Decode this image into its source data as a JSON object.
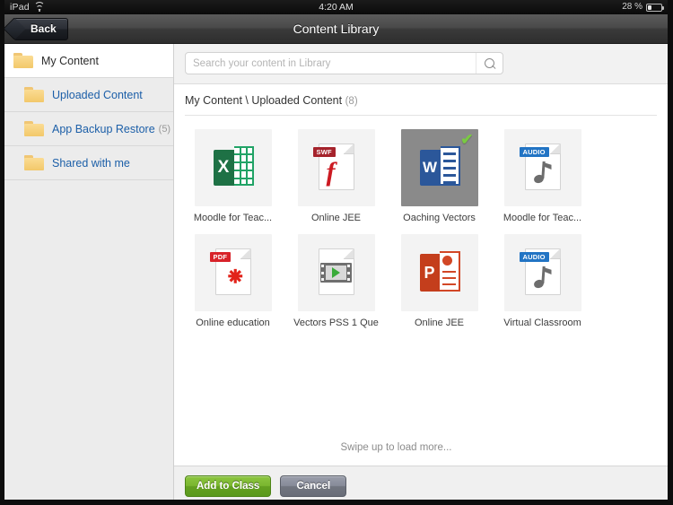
{
  "status_bar": {
    "carrier": "iPad",
    "wifi_icon": "wifi-icon",
    "time": "4:20 AM",
    "battery_percent": "28 %",
    "battery_level": 28
  },
  "nav_bar": {
    "back_label": "Back",
    "title": "Content Library"
  },
  "sidebar": {
    "items": [
      {
        "label": "My Content",
        "count": "",
        "level": "root",
        "icon": "folder-icon"
      },
      {
        "label": "Uploaded Content",
        "count": "",
        "level": "child",
        "icon": "folder-icon"
      },
      {
        "label": "App Backup Restore",
        "count": "(5)",
        "level": "child",
        "icon": "folder-icon"
      },
      {
        "label": "Shared with me",
        "count": "",
        "level": "child",
        "icon": "folder-icon"
      }
    ]
  },
  "search": {
    "value": "",
    "placeholder": "Search your content in Library",
    "icon": "search-icon"
  },
  "breadcrumb": {
    "path": "My Content \\ Uploaded Content",
    "count": "(8)"
  },
  "grid": {
    "tiles": [
      {
        "label": "Moodle for Teac...",
        "type": "excel",
        "selected": false,
        "letter": "X"
      },
      {
        "label": "Online JEE",
        "type": "swf",
        "selected": false,
        "badge": "SWF"
      },
      {
        "label": "Oaching Vectors",
        "type": "word",
        "selected": true,
        "letter": "W",
        "check": "✔"
      },
      {
        "label": "Moodle for Teac...",
        "type": "audio",
        "selected": false,
        "badge": "AUDIO"
      },
      {
        "label": "Online education",
        "type": "pdf",
        "selected": false,
        "badge": "PDF"
      },
      {
        "label": "Vectors PSS 1 Que",
        "type": "video",
        "selected": false
      },
      {
        "label": "Online JEE",
        "type": "powerpoint",
        "selected": false,
        "letter": "P"
      },
      {
        "label": "Virtual Classroom",
        "type": "audio",
        "selected": false,
        "badge": "AUDIO"
      }
    ],
    "swipe_hint": "Swipe up to load more..."
  },
  "footer": {
    "add_label": "Add to Class",
    "cancel_label": "Cancel"
  },
  "colors": {
    "accent_green": "#7ab62f",
    "check_green": "#7ac943",
    "link_blue": "#1c5fa8",
    "selected_tile_bg": "#8a8a8a"
  }
}
